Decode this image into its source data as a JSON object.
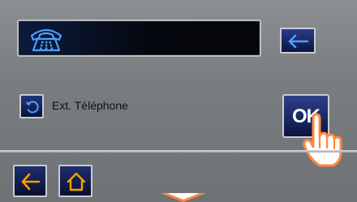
{
  "display": {
    "icon": "telephone-icon"
  },
  "top_actions": {
    "back_icon": "arrow-left-icon"
  },
  "ext_row": {
    "icon": "refresh-icon",
    "label": "Ext. Téléphone"
  },
  "confirm": {
    "label": "OK",
    "pointer_icon": "hand-pointer-icon"
  },
  "bottom_nav": {
    "back_icon": "arrow-left-icon",
    "home_icon": "home-icon"
  },
  "colors": {
    "screen_bg": "#7d8083",
    "button_blue": "#1b2a6b",
    "icon_blue": "#4aa0ff",
    "icon_orange": "#f5a000",
    "hand_orange": "#ff8a3c"
  }
}
